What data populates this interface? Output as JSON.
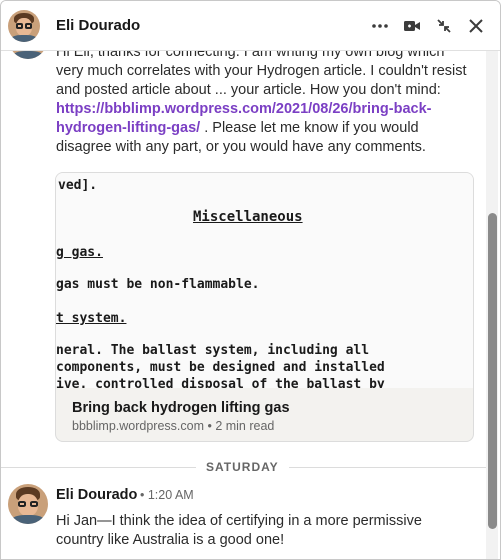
{
  "header": {
    "name": "Eli Dourado",
    "avatar_alt": "Eli Dourado profile photo"
  },
  "thread": {
    "message1": {
      "text_before": "Hi Eli, thanks for connecting. I am writing my own blog which very much correlates with your Hydrogen article. I couldn't resist and posted article about ... your article. How you don't mind: ",
      "link": "https://bbblimp.wordpress.com/2021/08/26/bring-back-hydrogen-lifting-gas/",
      "text_after": " . Please let me know if you would disagree with any part, or you would have any comments."
    },
    "link_card": {
      "image_lines": [
        "ved].",
        "Miscellaneous",
        "g gas.",
        "gas must be non-flammable.",
        "t system.",
        "neral.  The ballast system, including all",
        "components, must be designed and installed",
        "ive. controlled disposal of the ballast by"
      ],
      "title": "Bring back hydrogen lifting gas",
      "subtitle": "bbblimp.wordpress.com • 2 min read"
    },
    "day_separator": "SATURDAY",
    "message2": {
      "sender": "Eli Dourado",
      "timestamp": "• 1:20 AM",
      "text": "Hi Jan—I think the idea of certifying in a more permissive country like Australia is a good one!"
    }
  },
  "colors": {
    "link": "#7b3fc4",
    "text": "#2b2b2b",
    "muted": "#666666"
  }
}
